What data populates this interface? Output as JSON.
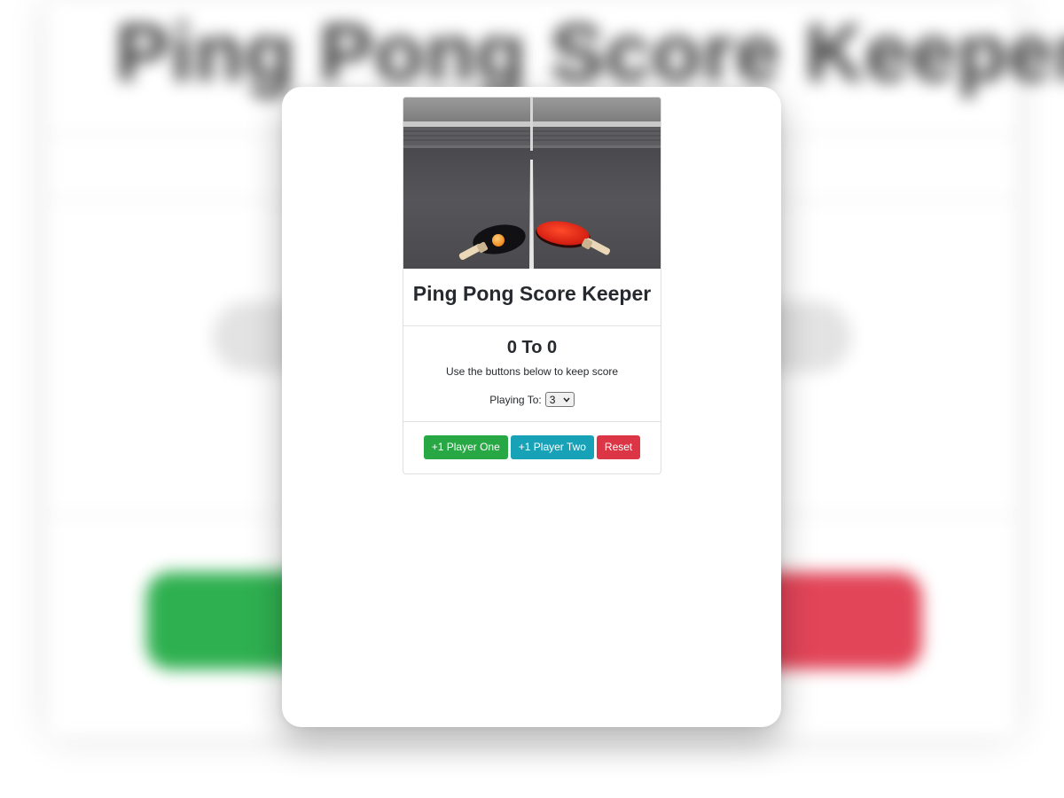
{
  "app": {
    "background_title": "Ping Pong Score Keeper"
  },
  "card": {
    "image_alt": "Two ping pong paddles and a ball on a table",
    "title": "Ping Pong Score Keeper",
    "score_text": "0 To 0",
    "hint": "Use the buttons below to keep score",
    "playing_to_label": "Playing To:",
    "playing_to_value": "3",
    "buttons": {
      "player_one": "+1 Player One",
      "player_two": "+1 Player Two",
      "reset": "Reset"
    }
  },
  "colors": {
    "success": "#28a745",
    "info": "#17a2b8",
    "danger": "#dc3545"
  }
}
